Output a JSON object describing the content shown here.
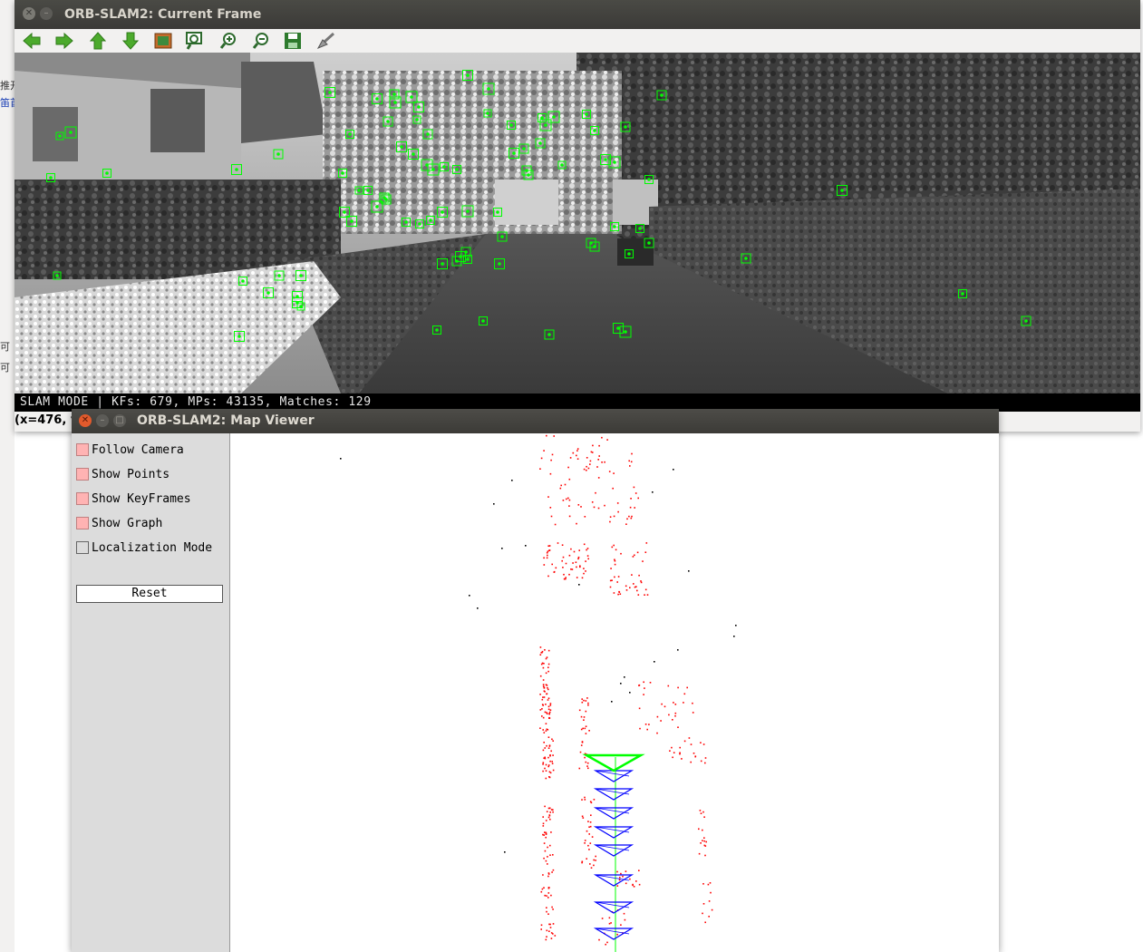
{
  "background": {
    "left_texts": [
      "推开",
      "笛首",
      "可",
      "可"
    ]
  },
  "current_frame": {
    "title": "ORB-SLAM2: Current Frame",
    "toolbar": [
      {
        "icon": "arrow-left-icon",
        "color": "#4caa2c"
      },
      {
        "icon": "arrow-right-icon",
        "color": "#4caa2c"
      },
      {
        "icon": "arrow-up-icon",
        "color": "#4caa2c"
      },
      {
        "icon": "arrow-down-icon",
        "color": "#4caa2c"
      },
      {
        "icon": "image-icon",
        "color": "#c46b2a"
      },
      {
        "icon": "zoom-fit-icon",
        "color": "#2d6a2d"
      },
      {
        "icon": "zoom-in-icon",
        "color": "#2d6a2d"
      },
      {
        "icon": "zoom-out-icon",
        "color": "#2d6a2d"
      },
      {
        "icon": "save-icon",
        "color": "#2d7a2d"
      },
      {
        "icon": "brush-icon",
        "color": "#777777"
      }
    ],
    "status": "SLAM MODE |  KFs: 679, MPs: 43135, Matches: 129",
    "coords": "(x=476, y",
    "feature_color": "#00ff00"
  },
  "map_viewer": {
    "title": "ORB-SLAM2: Map Viewer",
    "options": [
      {
        "label": "Follow Camera",
        "checked": true
      },
      {
        "label": "Show Points",
        "checked": true
      },
      {
        "label": "Show KeyFrames",
        "checked": true
      },
      {
        "label": "Show Graph",
        "checked": true
      },
      {
        "label": "Localization Mode",
        "checked": false
      }
    ],
    "reset_label": "Reset",
    "colors": {
      "map_points": "#ff0000",
      "reference_points": "#000000",
      "keyframes": "#0000ff",
      "current_camera": "#00ff00",
      "graph": "#00ff00"
    }
  }
}
